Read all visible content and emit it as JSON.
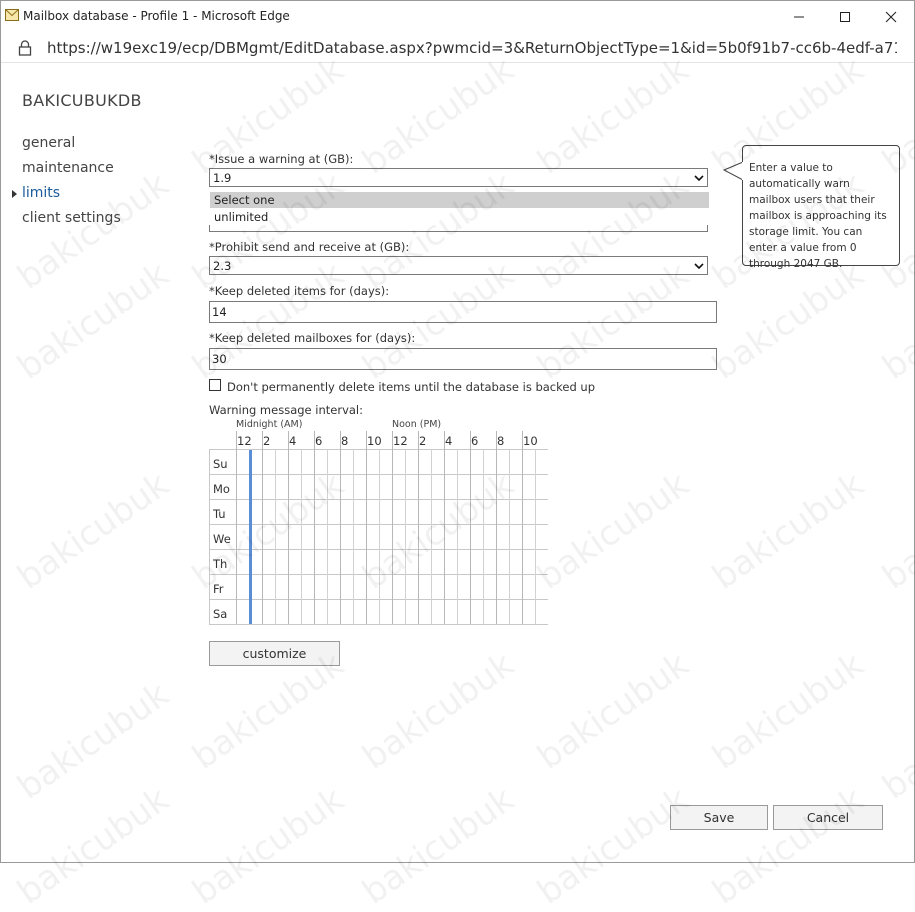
{
  "window": {
    "title": "Mailbox database - Profile 1 - Microsoft Edge",
    "url": "https://w19exc19/ecp/DBMgmt/EditDatabase.aspx?pwmcid=3&ReturnObjectType=1&id=5b0f91b7-cc6b-4edf-a71d-5..."
  },
  "sidebar": {
    "db_name": "BAKICUBUKDB",
    "items": [
      {
        "label": "general"
      },
      {
        "label": "maintenance"
      },
      {
        "label": "limits"
      },
      {
        "label": "client settings"
      }
    ],
    "active_index": 2
  },
  "form": {
    "warning": {
      "label": "*Issue a warning at (GB):",
      "value": "1.9"
    },
    "dropdown_options": [
      "Select one",
      "unlimited"
    ],
    "prohibit": {
      "label": "*Prohibit send and receive at (GB):",
      "value": "2.3"
    },
    "keep_items": {
      "label": "*Keep deleted items for (days):",
      "value": "14"
    },
    "keep_mailboxes": {
      "label": "*Keep deleted mailboxes for (days):",
      "value": "30"
    },
    "backup_checkbox": {
      "label": "Don't permanently delete items until the database is backed up",
      "checked": false
    }
  },
  "schedule": {
    "title": "Warning message interval:",
    "am_label": "Midnight (AM)",
    "pm_label": "Noon (PM)",
    "hours": [
      "12",
      "2",
      "4",
      "6",
      "8",
      "10",
      "12",
      "2",
      "4",
      "6",
      "8",
      "10"
    ],
    "days": [
      "Su",
      "Mo",
      "Tu",
      "We",
      "Th",
      "Fr",
      "Sa"
    ],
    "active_color": "#5b8dd6"
  },
  "buttons": {
    "customize": "customize",
    "save": "Save",
    "cancel": "Cancel"
  },
  "tooltip": {
    "text": "Enter a value to automatically warn mailbox users that their mailbox is approaching its storage limit. You can enter a value from 0 through 2047 GB."
  },
  "watermark": "bakicubuk"
}
